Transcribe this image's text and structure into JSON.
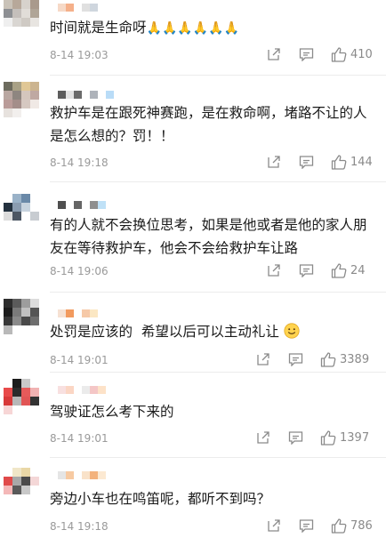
{
  "comments": [
    {
      "text": "时间就是生命呀",
      "emoji": "🙏🙏🙏🙏🙏🙏",
      "time": "8-14 19:03",
      "likes": "410",
      "avatar": [
        "#c9c2b8",
        "#b7a89a",
        "#d7d2cc",
        "#a99a8c",
        "#8d8f93",
        "#c4bfbb",
        "#e1ddd8",
        "#b0a597",
        "#efefef",
        "#d9d6d2",
        "#cfcac4",
        "#e8e5e1",
        "#ffffff",
        "#ffffff",
        "#ffffff",
        "#ffffff"
      ],
      "name_colors": [
        "#ffffff",
        "#f6d9c7",
        "#f5b08a",
        "#ffffff",
        "#e0e0e0",
        "#cfd6de"
      ]
    },
    {
      "text": "救护车是在跟死神赛跑，是在救命啊，堵路不让的人是怎么想的？罚！！",
      "time": "8-14 19:18",
      "likes": "144",
      "avatar": [
        "#6d6b5e",
        "#a9a186",
        "#e0c795",
        "#ccb48f",
        "#b9a7a1",
        "#8e8680",
        "#d4c6bd",
        "#bfa8a2",
        "#ba9c99",
        "#a48e8a",
        "#d6c8c1",
        "#f0e9e5",
        "#e7e2de",
        "#f2efed",
        "#ffffff",
        "#ffffff"
      ],
      "name_colors": [
        "#ffffff",
        "#5d5d5d",
        "#e3e3e3",
        "#6b6b6b",
        "#ffffff",
        "#aeb3ba",
        "#ffffff",
        "#b9dcf7"
      ]
    },
    {
      "text": "有的人就不会换位思考，如果是他或者是他的家人朋友在等待救护车，他会不会给救护车让路",
      "time": "8-14 19:06",
      "likes": "24",
      "avatar": [
        "#ffffff",
        "#9ab2c8",
        "#6a89a8",
        "#ffffff",
        "#24323f",
        "#8a9cb0",
        "#c7d3de",
        "#ffffff",
        "#dcdcdc",
        "#4c5663",
        "#ffffff",
        "#c8ccd1",
        "#ffffff",
        "#ffffff",
        "#ffffff",
        "#ffffff"
      ],
      "name_colors": [
        "#ffffff",
        "#4f4f4f",
        "#ffffff",
        "#666666",
        "#ffffff",
        "#8f8f8f",
        "#bfe1f7"
      ]
    },
    {
      "text": "处罚是应该的  希望以后可以主动礼让",
      "time": "8-14 19:01",
      "likes": "3389",
      "avatar": [
        "#2e2e2e",
        "#5b5b5b",
        "#9d9d9d",
        "#dcdcdc",
        "#1d1d1d",
        "#7a7a7a",
        "#c1c1c1",
        "#555555",
        "#383838",
        "#8a8a8a",
        "#4a4a4a",
        "#6e6e6e",
        "#b9b9b9",
        "#ffffff",
        "#ffffff",
        "#ffffff"
      ],
      "name_colors": [
        "#ffffff",
        "#f6e1d3",
        "#f29a5e",
        "#ffffff",
        "#f6c9a8",
        "#fbe7c3"
      ]
    },
    {
      "text": "驾驶证怎么考下来的",
      "time": "8-14 19:01",
      "likes": "1397",
      "avatar": [
        "#ffffff",
        "#1c1c1c",
        "#c9c9c9",
        "#ffffff",
        "#e84a4a",
        "#2b2b2b",
        "#e65a5a",
        "#f1b3b3",
        "#d83a3a",
        "#b7b7b7",
        "#e15555",
        "#333333",
        "#f7d6d6",
        "#ffffff",
        "#ffffff",
        "#ffffff"
      ],
      "name_colors": [
        "#ffffff",
        "#f8e0e0",
        "#fbd6c4",
        "#ffffff",
        "#ebebeb",
        "#f4c6c6",
        "#fde2c8"
      ]
    },
    {
      "text": "旁边小车也在鸣笛呢，都听不到吗？",
      "time": "8-14 19:18",
      "likes": "786",
      "avatar": [
        "#ffffff",
        "#f0e6c8",
        "#e9d7a6",
        "#ffffff",
        "#e04a4a",
        "#a8a8a8",
        "#4a4a4a",
        "#f4d7d7",
        "#f4b8b8",
        "#5a5a5a",
        "#c8c8c8",
        "#ffffff",
        "#ffffff",
        "#ffffff",
        "#ffffff",
        "#ffffff"
      ],
      "name_colors": [
        "#ffffff",
        "#e5e5e5",
        "#f7caa2",
        "#ffffff",
        "#f9e2c9",
        "#f3b27c",
        "#fce9d2"
      ]
    }
  ]
}
